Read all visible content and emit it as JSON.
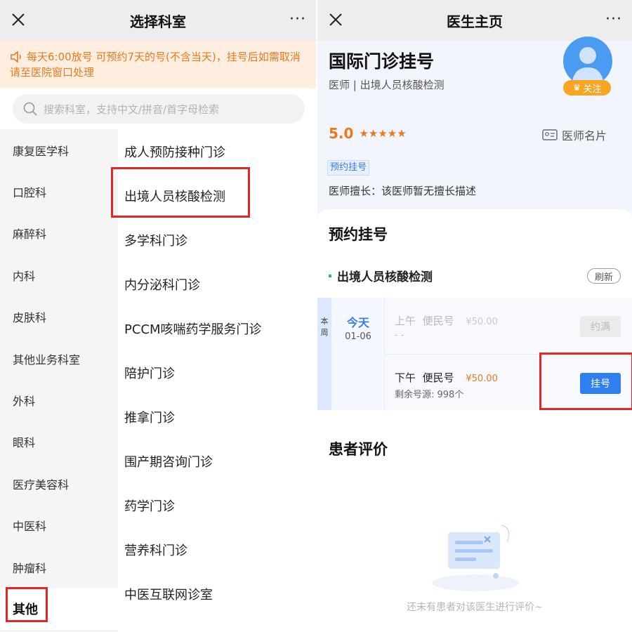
{
  "left": {
    "nav": {
      "title": "选择科室",
      "more": "···"
    },
    "notice": "每天6:00放号 可预约7天的号(不含当天)，挂号后如需取消请至医院窗口处理",
    "search": {
      "placeholder": "搜索科室，支持中文/拼音/首字母检索"
    },
    "categories": [
      "康复医学科",
      "口腔科",
      "麻醉科",
      "内科",
      "皮肤科",
      "其他业务科室",
      "外科",
      "眼科",
      "医疗美容科",
      "中医科",
      "肿瘤科",
      "其他"
    ],
    "active_category": "其他",
    "departments": [
      "成人预防接种门诊",
      "出境人员核酸检测",
      "多学科门诊",
      "内分泌科门诊",
      "PCCM咳喘药学服务门诊",
      "陪护门诊",
      "推拿门诊",
      "围产期咨询门诊",
      "药学门诊",
      "营养科门诊",
      "中医互联网诊室"
    ],
    "highlighted_department": "出境人员核酸检测"
  },
  "right": {
    "nav": {
      "title": "医生主页",
      "more": "···"
    },
    "doctor": {
      "name": "国际门诊挂号",
      "subtitle": "医师 | 出境人员核酸检测",
      "follow_label": "关注",
      "rating": "5.0",
      "stars": 5,
      "card_label": "医师名片",
      "tag": "预约挂号",
      "specialty": "医师擅长：该医师暂无擅长描述"
    },
    "schedule": {
      "section_title": "预约挂号",
      "department": "出境人员核酸检测",
      "refresh_label": "刷新",
      "week_label": "本周",
      "day": {
        "name": "今天",
        "date": "01-06"
      },
      "slots": [
        {
          "period": "上午",
          "type": "便民号",
          "price": "¥50.00",
          "remaining": "- -",
          "button": "约满",
          "available": false
        },
        {
          "period": "下午",
          "type": "便民号",
          "price": "¥50.00",
          "remaining": "剩余号源: 998个",
          "button": "挂号",
          "available": true
        }
      ]
    },
    "reviews": {
      "section_title": "患者评价",
      "empty_text": "还未有患者对该医生进行评价~"
    }
  },
  "colors": {
    "accent_blue": "#2f7ff0",
    "notice_orange": "#e9791f",
    "highlight_red": "#e02828",
    "follow_gold": "#f6a623"
  }
}
